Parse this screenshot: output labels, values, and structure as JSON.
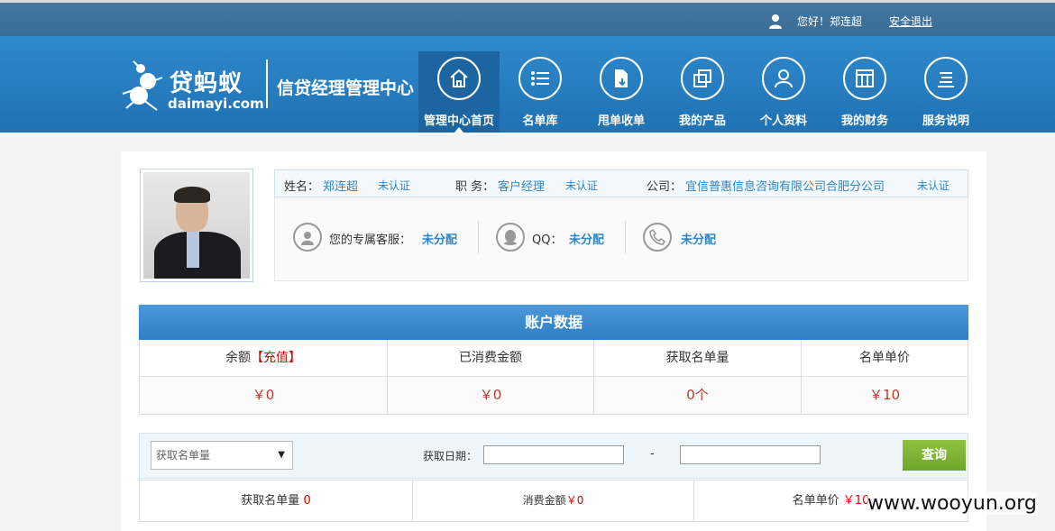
{
  "topbar": {
    "greeting": "您好！郑连超",
    "logout": "安全退出"
  },
  "brand": {
    "name_cn": "贷蚂蚁",
    "name_en": "daimayi.com",
    "site_title": "信贷经理管理中心"
  },
  "nav": [
    {
      "label": "管理中心首页",
      "icon": "home-icon",
      "active": true
    },
    {
      "label": "名单库",
      "icon": "list-icon",
      "active": false
    },
    {
      "label": "甩单收单",
      "icon": "document-download-icon",
      "active": false
    },
    {
      "label": "我的产品",
      "icon": "stacked-windows-icon",
      "active": false
    },
    {
      "label": "个人资料",
      "icon": "person-icon",
      "active": false
    },
    {
      "label": "我的财务",
      "icon": "grid-table-icon",
      "active": false
    },
    {
      "label": "服务说明",
      "icon": "lines-icon",
      "active": false
    }
  ],
  "profile": {
    "name_label": "姓名：",
    "name": "郑连超",
    "name_status": "未认证",
    "position_label": "职 务：",
    "position": "客户经理",
    "position_status": "未认证",
    "company_label": "公司：",
    "company": "宜信普惠信息咨询有限公司合肥分公司",
    "company_status": "未认证"
  },
  "contacts": {
    "service_label": "您的专属客服：",
    "service_value": "未分配",
    "qq_label": "QQ：",
    "qq_value": "未分配",
    "phone_value": "未分配"
  },
  "account": {
    "title": "账户数据",
    "headers": {
      "balance": "余额",
      "recharge": "【充值】",
      "consumed": "已消费金额",
      "list_count": "获取名单量",
      "unit_price": "名单单价"
    },
    "values": {
      "balance": "￥0",
      "consumed": "￥0",
      "list_count": "0个",
      "unit_price": "￥10"
    }
  },
  "filter": {
    "select_value": "获取名单量",
    "date_label": "获取日期：",
    "dash": "-",
    "query": "查询"
  },
  "summary": {
    "list_label": "获取名单量",
    "list_value": "0",
    "spent_label": "消费金额",
    "spent_value": "￥0",
    "price_label": "名单单价",
    "price_value": "￥10"
  },
  "watermark": "www.wooyun.org",
  "colors": {
    "topbar": "#3a6d96",
    "header": "#2680c2",
    "accent_link": "#2c86c8",
    "value_red": "#c0392b",
    "query_green": "#7ab030"
  }
}
